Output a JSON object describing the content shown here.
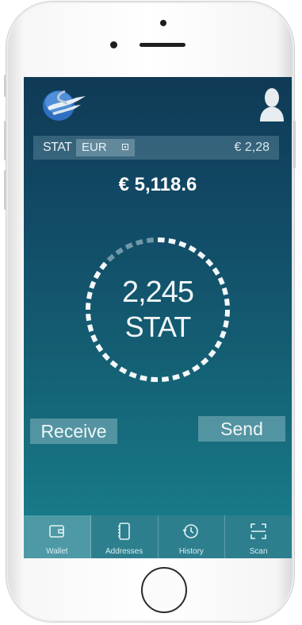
{
  "ticker": {
    "symbol": "STAT",
    "currency": "EUR",
    "rate": "€ 2,28"
  },
  "balance": {
    "fiat": "€ 5,118.6",
    "amount": "2,245",
    "unit": "STAT"
  },
  "actions": {
    "receive_label": "Receive",
    "send_label": "Send"
  },
  "tabs": [
    {
      "label": "Wallet",
      "icon": "wallet-icon",
      "active": true
    },
    {
      "label": "Addresses",
      "icon": "addresses-icon",
      "active": false
    },
    {
      "label": "History",
      "icon": "history-icon",
      "active": false
    },
    {
      "label": "Scan",
      "icon": "scan-icon",
      "active": false
    }
  ],
  "colors": {
    "screen_top": "#0f3a55",
    "screen_bottom": "#1a8190",
    "tabbar": "#2d7f8e",
    "tab_active": "#4d9aa6",
    "logo_blue": "#2f6fc0"
  },
  "icons": {
    "logo": "stat-logo",
    "profile": "profile-icon"
  }
}
